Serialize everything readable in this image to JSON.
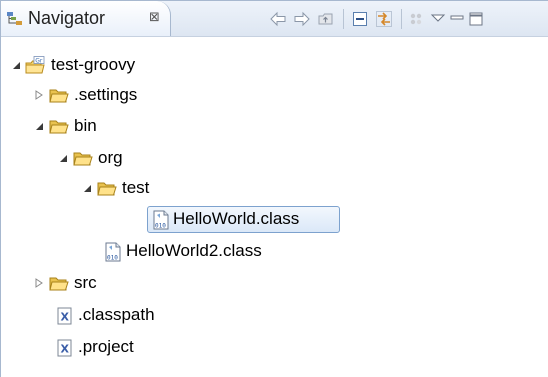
{
  "view": {
    "title": "Navigator",
    "close_glyph": "⊠",
    "toolbar": [
      {
        "name": "back-icon"
      },
      {
        "name": "forward-icon"
      },
      {
        "name": "up-icon"
      },
      {
        "name": "collapse-all-icon"
      },
      {
        "name": "link-with-editor-icon"
      },
      {
        "name": "working-set-icon"
      },
      {
        "name": "view-menu-icon"
      },
      {
        "name": "minimize-icon"
      },
      {
        "name": "maximize-icon"
      }
    ]
  },
  "tree": {
    "items": [
      {
        "label": "test-groovy",
        "icon": "groovy-project-icon",
        "state": "expanded"
      },
      {
        "label": ".settings",
        "icon": "folder-icon",
        "state": "collapsed"
      },
      {
        "label": "bin",
        "icon": "folder-icon",
        "state": "expanded"
      },
      {
        "label": "org",
        "icon": "folder-icon",
        "state": "expanded"
      },
      {
        "label": "test",
        "icon": "folder-icon",
        "state": "expanded"
      },
      {
        "label": "HelloWorld.class",
        "icon": "class-file-icon",
        "state": "leaf",
        "selected": true
      },
      {
        "label": "HelloWorld2.class",
        "icon": "class-file-icon",
        "state": "leaf"
      },
      {
        "label": "src",
        "icon": "folder-icon",
        "state": "collapsed"
      },
      {
        "label": ".classpath",
        "icon": "xml-file-icon",
        "state": "leaf"
      },
      {
        "label": ".project",
        "icon": "xml-file-icon",
        "state": "leaf"
      }
    ]
  },
  "colors": {
    "selection_border": "#7da2ce",
    "folder": "#e9c24f",
    "tab_border": "#a7b8cf"
  }
}
